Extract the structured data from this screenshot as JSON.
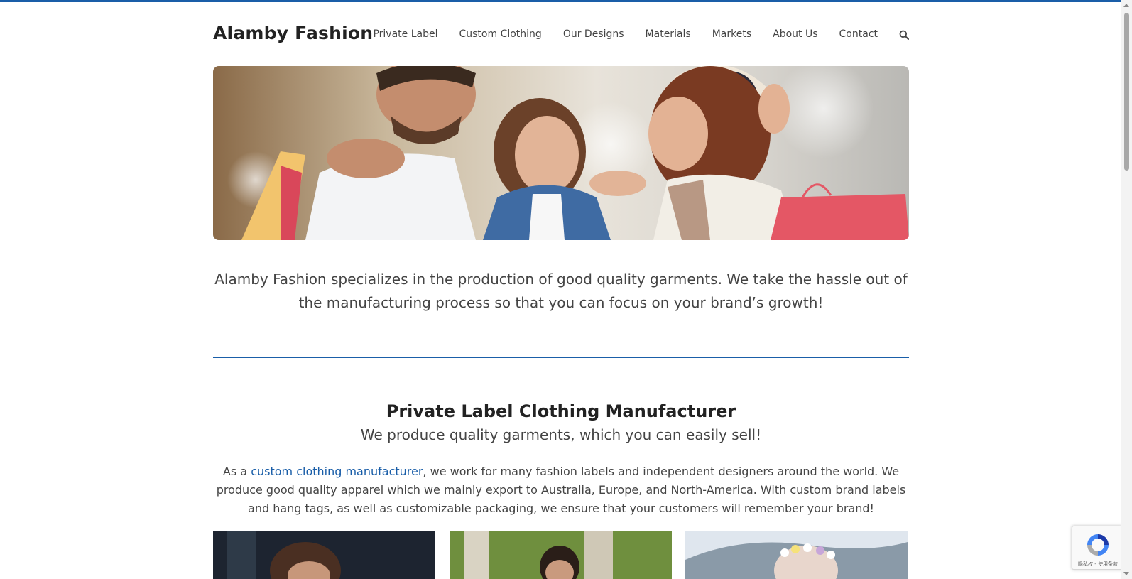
{
  "header": {
    "logo": "Alamby Fashion",
    "nav": [
      "Private Label",
      "Custom Clothing",
      "Our Designs",
      "Materials",
      "Markets",
      "About Us",
      "Contact"
    ]
  },
  "intro": {
    "text": "Alamby Fashion specializes in the production of good quality garments. We take the hassle out of the manufacturing process so that you can focus on your brand’s growth!"
  },
  "section": {
    "title": "Private Label Clothing Manufacturer",
    "subtitle": "We produce quality garments, which you can easily sell!",
    "body_before": "As a ",
    "body_link": "custom clothing manufacturer",
    "body_after": ", we work for many fashion labels and independent designers around the world. We produce good quality apparel which we mainly export to Australia, Europe, and North-America. With custom brand labels and hang tags, as well as customizable packaging, we ensure that your customers will remember your brand!"
  },
  "recaptcha": {
    "text": "隐私权 - 使用条款"
  },
  "colors": {
    "accent": "#1a5ea8",
    "text": "#444444",
    "heading": "#222222"
  },
  "icons": {
    "search": "search-icon"
  }
}
